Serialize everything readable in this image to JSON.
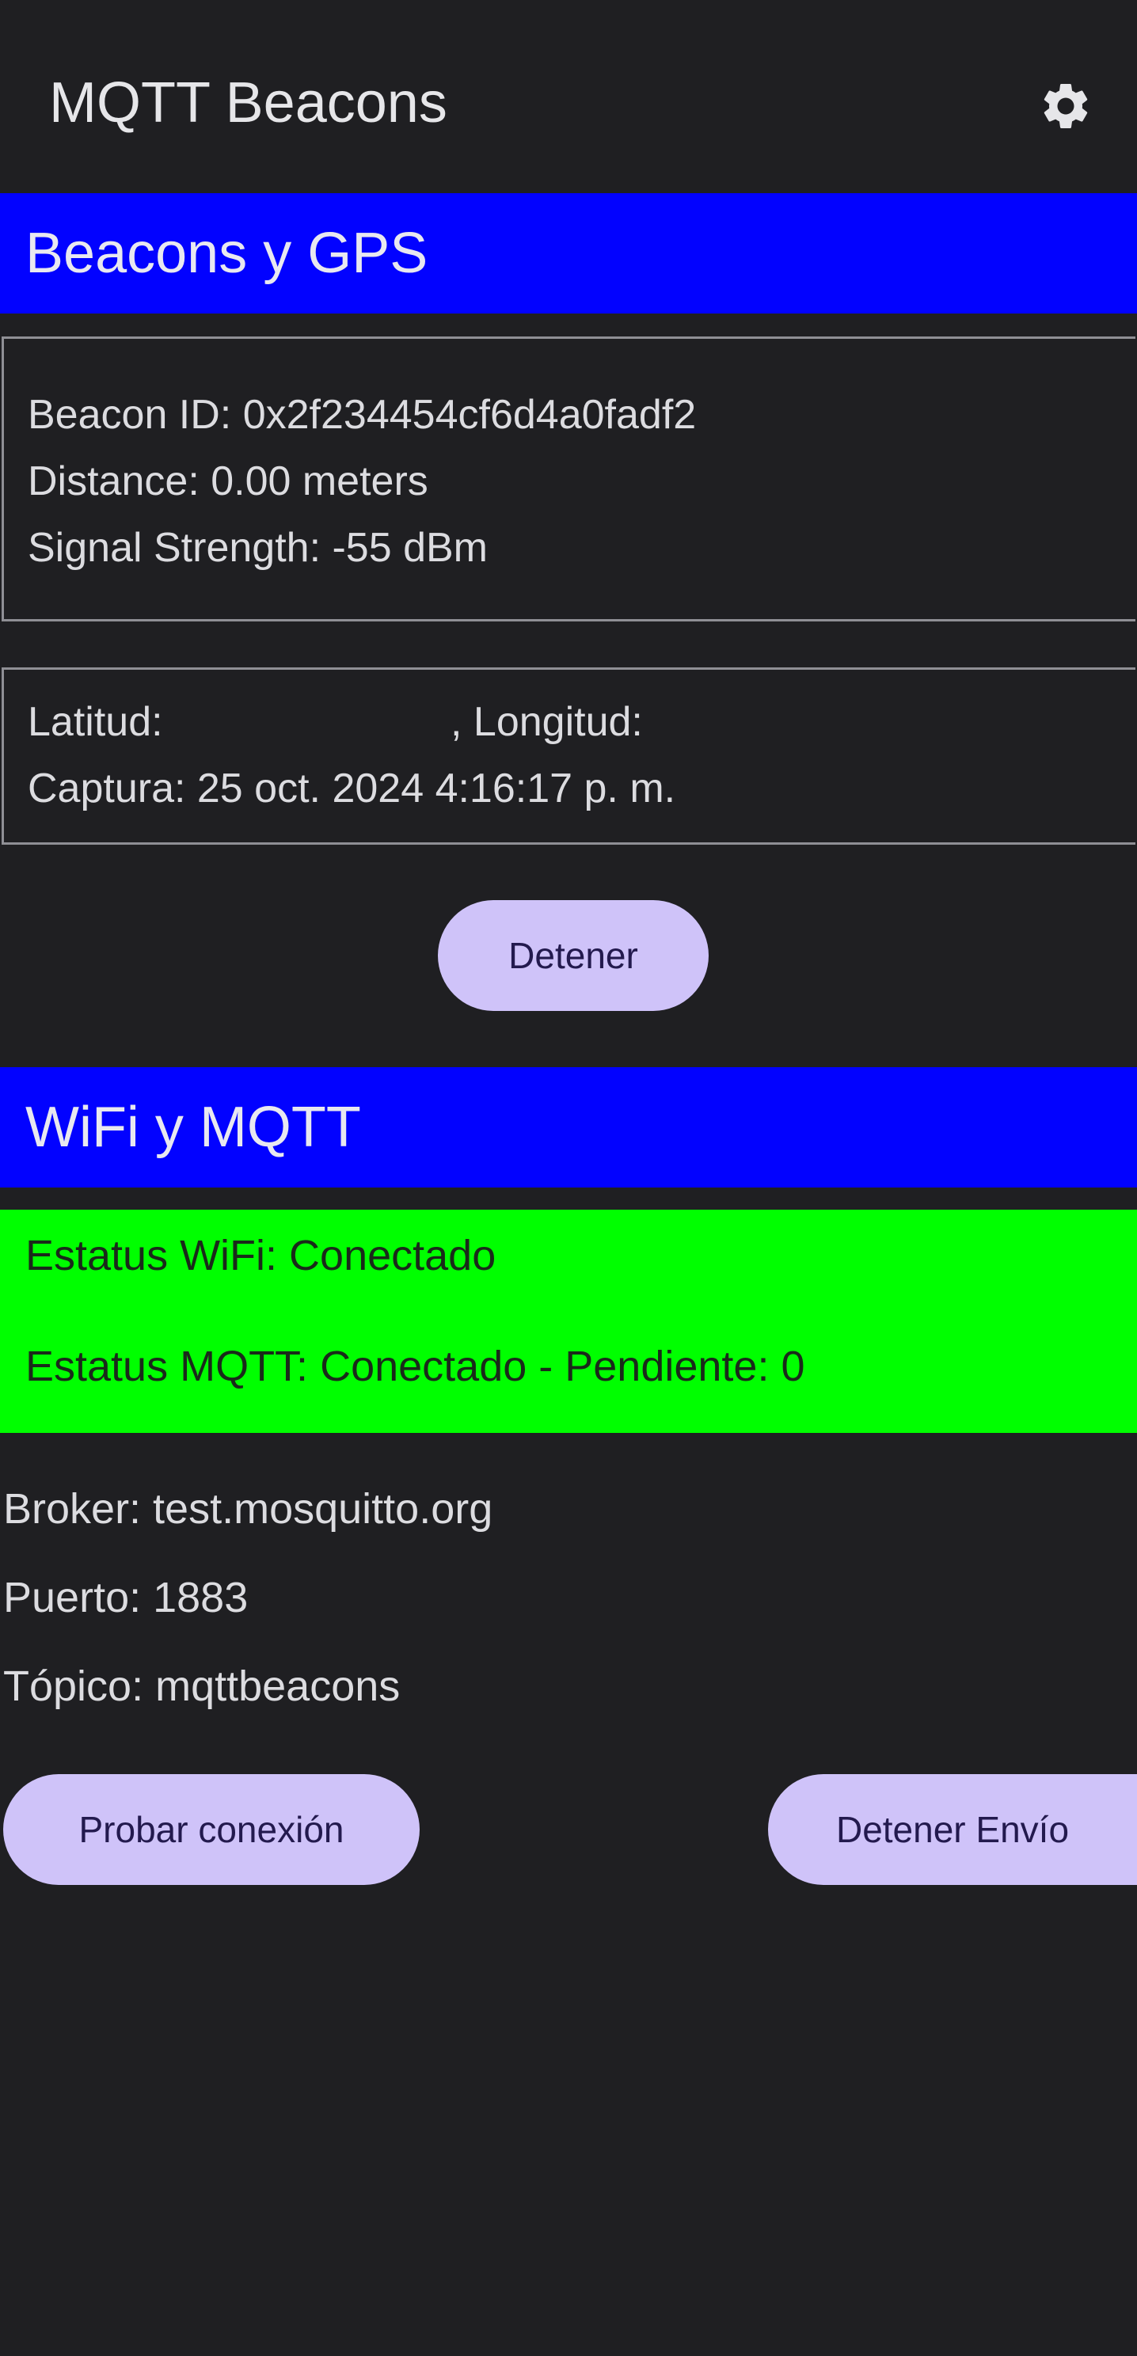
{
  "app": {
    "title": "MQTT Beacons",
    "settings_icon": "gear-icon"
  },
  "beacons_section": {
    "title": "Beacons y GPS",
    "beacon": {
      "id_line": "Beacon ID: 0x2f234454cf6d4a0fadf2",
      "distance_line": "Distance: 0.00 meters",
      "signal_line": "Signal Strength: -55 dBm"
    },
    "gps": {
      "latitude_label": "Latitud:",
      "longitude_label": ", Longitud:",
      "capture_line": "Captura: 25 oct. 2024 4:16:17 p. m."
    },
    "stop_button": "Detener"
  },
  "wifi_section": {
    "title": "WiFi y MQTT",
    "wifi_status": "Estatus WiFi: Conectado",
    "mqtt_status": "Estatus MQTT: Conectado - Pendiente: 0",
    "broker": "Broker: test.mosquitto.org",
    "port": "Puerto: 1883",
    "topic": "Tópico: mqttbeacons",
    "test_button": "Probar conexión",
    "stop_send_button": "Detener Envío"
  },
  "colors": {
    "background": "#1f1f22",
    "section_header": "#0202ff",
    "status_ok": "#00ff00",
    "button": "#cfc3f9",
    "button_text": "#231a4e"
  }
}
